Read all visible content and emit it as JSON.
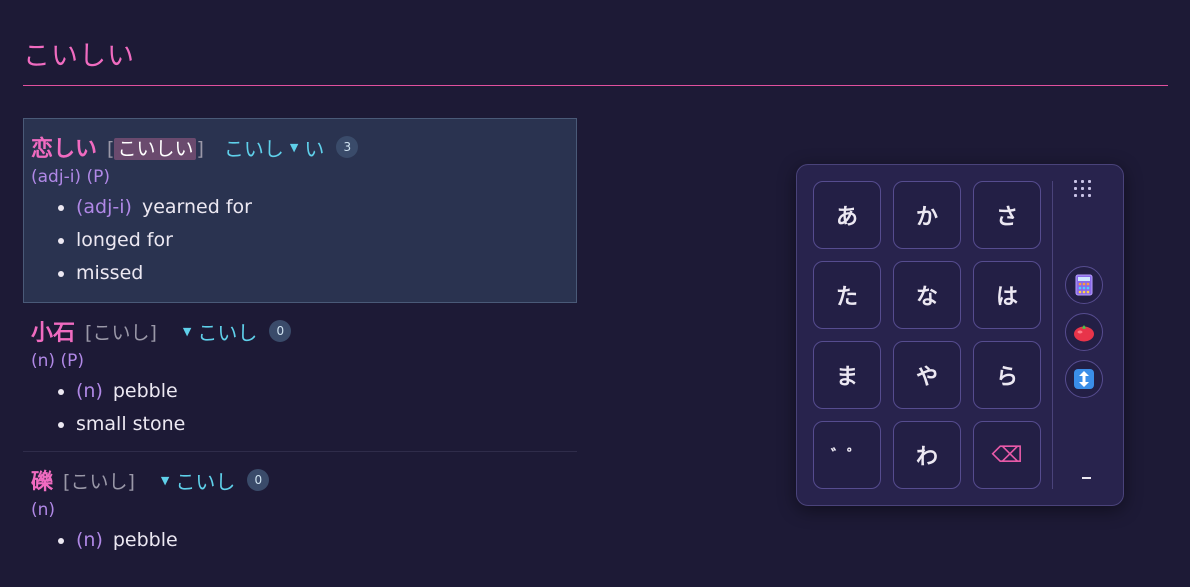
{
  "header": {
    "title": "こいしい"
  },
  "entries": [
    {
      "kanji": "恋しい",
      "reading": "こいしい",
      "conj_stem": "こいし",
      "conj_ending": "い",
      "count": "3",
      "pos": "(adj-i) (P)",
      "senses": [
        {
          "tag": "(adj-i)",
          "text": "yearned for"
        },
        {
          "tag": "",
          "text": "longed for"
        },
        {
          "tag": "",
          "text": "missed"
        }
      ]
    },
    {
      "kanji": "小石",
      "reading": "こいし",
      "conj_stem": "こいし",
      "count": "0",
      "pos": "(n) (P)",
      "senses": [
        {
          "tag": "(n)",
          "text": "pebble"
        },
        {
          "tag": "",
          "text": "small stone"
        }
      ]
    },
    {
      "kanji": "礫",
      "reading": "こいし",
      "conj_stem": "こいし",
      "count": "0",
      "pos": "(n)",
      "senses": [
        {
          "tag": "(n)",
          "text": "pebble"
        }
      ]
    }
  ],
  "keypad": {
    "keys": [
      "あ",
      "か",
      "さ",
      "た",
      "な",
      "は",
      "ま",
      "や",
      "ら",
      "゛゜",
      "わ",
      "⌫"
    ],
    "side_icons": [
      "grid-icon",
      "abacus-icon",
      "tomato-icon",
      "up-down-arrow-icon"
    ],
    "colors": {
      "accent": "#f06bc0",
      "conj": "#5fd0ea",
      "pos": "#b088e6"
    }
  }
}
